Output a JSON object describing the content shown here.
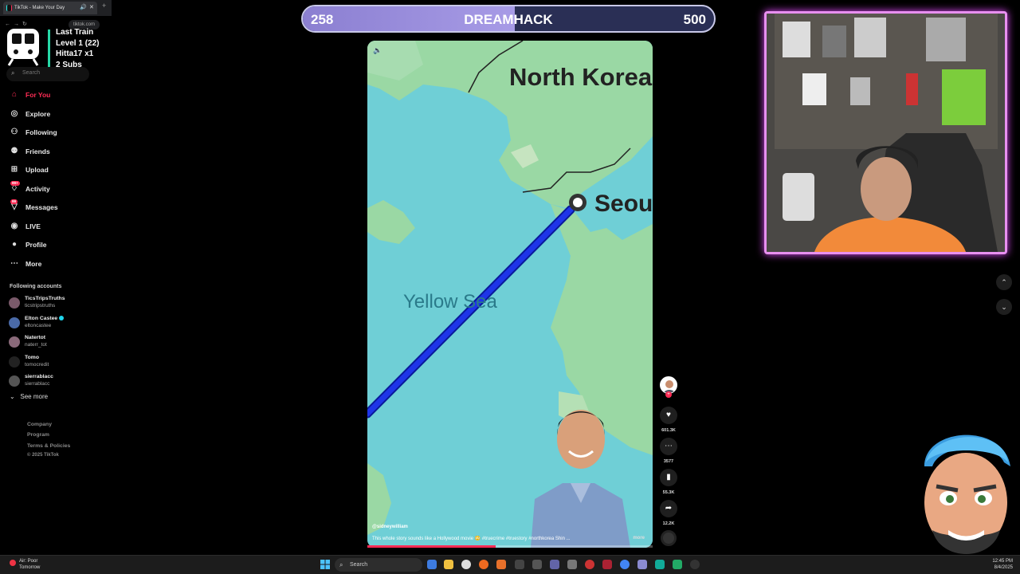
{
  "browser": {
    "tab_title": "TikTok - Make Your Day",
    "url": "tiktok.com"
  },
  "overlay_train": {
    "lines": [
      "Last Train",
      "Level 1  (22)",
      "Hitta17 x1",
      "2 Subs"
    ]
  },
  "search": {
    "placeholder": "Search"
  },
  "nav": {
    "items": [
      {
        "label": "For You",
        "icon": "home-icon",
        "active": true
      },
      {
        "label": "Explore",
        "icon": "compass-icon"
      },
      {
        "label": "Following",
        "icon": "following-icon"
      },
      {
        "label": "Friends",
        "icon": "friends-icon"
      },
      {
        "label": "Upload",
        "icon": "upload-icon"
      },
      {
        "label": "Activity",
        "icon": "activity-icon",
        "badge": "99+"
      },
      {
        "label": "Messages",
        "icon": "messages-icon",
        "badge": "99"
      },
      {
        "label": "LIVE",
        "icon": "live-icon"
      },
      {
        "label": "Profile",
        "icon": "profile-icon"
      },
      {
        "label": "More",
        "icon": "more-icon"
      }
    ]
  },
  "following": {
    "title": "Following accounts",
    "accounts": [
      {
        "name": "TicsTripsTruths",
        "handle": "ticstripstruths"
      },
      {
        "name": "Elton Castee",
        "handle": "eltoncastee",
        "verified": true
      },
      {
        "name": "Natertot",
        "handle": "naterr_tot"
      },
      {
        "name": "Tomo",
        "handle": "tomocredit"
      },
      {
        "name": "sierrablacc",
        "handle": "sierrablacc"
      }
    ],
    "see_more": "See more"
  },
  "footer": {
    "links": [
      "Company",
      "Program",
      "Terms & Policies"
    ],
    "copyright": "© 2025 TikTok"
  },
  "scorebar": {
    "current": "258",
    "title": "DREAMHACK",
    "max": "500",
    "progress": 0.516
  },
  "video": {
    "map_labels": {
      "country": "North Korea",
      "city": "Seou",
      "sea": "Yellow Sea"
    },
    "author": "@sidneywilliam",
    "caption": "This whole story sounds like a Hollywood movie 😳 #truecrime #truestory #northkorea  Shin ...",
    "more": "more",
    "progress": 0.45
  },
  "actions": {
    "likes": "601.3K",
    "comments": "3577",
    "saves": "55.3K",
    "shares": "12.2K"
  },
  "taskbar": {
    "weather_line1": "Air: Poor",
    "weather_line2": "Tomorrow",
    "search_label": "Search",
    "time": "12:45 PM",
    "date": "8/4/2025"
  },
  "colors": {
    "accent": "#fe2c55",
    "route": "#1e2fd6",
    "sea": "#6fcfd6",
    "land": "#9ad8a4",
    "scorebar_fill": "#9a8de0",
    "cam_border": "#e44cff"
  }
}
